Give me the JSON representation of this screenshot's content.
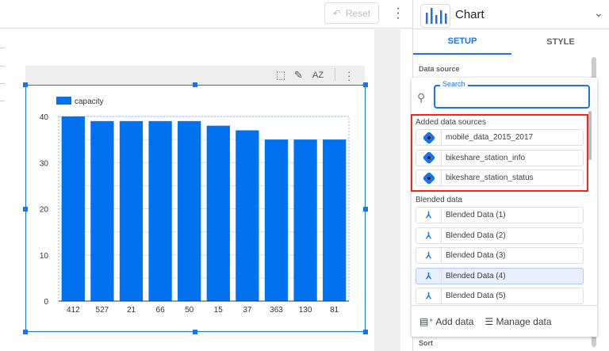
{
  "toolbar": {
    "reset_label": "Reset",
    "reset_icon": "undo-icon",
    "more_icon": "more-vert-icon"
  },
  "chart_toolbar": {
    "icons": [
      "select-icon",
      "pencil-icon",
      "sort-az-icon",
      "more-vert-icon"
    ],
    "sort_glyph": "AZ"
  },
  "chart_data": {
    "type": "bar",
    "categories": [
      "412",
      "527",
      "21",
      "66",
      "50",
      "15",
      "37",
      "363",
      "130",
      "81"
    ],
    "series": [
      {
        "name": "capacity",
        "values": [
          40,
          39,
          39,
          39,
          39,
          38,
          37,
          35,
          35,
          35
        ],
        "color": "#0072f0"
      }
    ],
    "yticks": [
      "0",
      "10",
      "20",
      "30",
      "40"
    ],
    "ylim": [
      0,
      40
    ],
    "grid": true,
    "legend": "top-left"
  },
  "panel": {
    "title": "Chart",
    "tabs": [
      {
        "label": "SETUP",
        "active": true
      },
      {
        "label": "STYLE",
        "active": false
      }
    ],
    "data_source_label": "Data source",
    "search_placeholder": "Search",
    "added_label": "Added data sources",
    "added": [
      "mobile_data_2015_2017",
      "bikeshare_station_info",
      "bikeshare_station_status"
    ],
    "blended_label": "Blended data",
    "blended": [
      "Blended Data (1)",
      "Blended Data (2)",
      "Blended Data (3)",
      "Blended Data (4)",
      "Blended Data (5)"
    ],
    "selected_blended": "Blended Data (4)",
    "add_data": "Add data",
    "manage_data": "Manage data",
    "sort_label": "Sort",
    "highlight_color": "#e8291c",
    "accent": "#1a73e8"
  }
}
